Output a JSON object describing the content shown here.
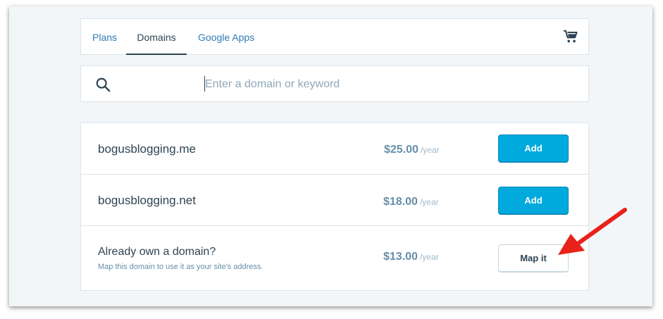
{
  "tabs": {
    "plans": "Plans",
    "domains": "Domains",
    "google_apps": "Google Apps",
    "active": "Domains"
  },
  "icons": {
    "cart": "shopping-cart-icon",
    "search": "search-icon",
    "annotation": "red-arrow-annotation"
  },
  "search": {
    "placeholder": "Enter a domain or keyword",
    "value": ""
  },
  "results": [
    {
      "domain": "bogusblogging.me",
      "price": "$25.00",
      "period": "/year",
      "action": "Add"
    },
    {
      "domain": "bogusblogging.net",
      "price": "$18.00",
      "period": "/year",
      "action": "Add"
    }
  ],
  "mapping": {
    "title": "Already own a domain?",
    "subtitle": "Map this domain to use it as your site's address.",
    "price": "$13.00",
    "period": "/year",
    "action": "Map it"
  },
  "colors": {
    "primary_button": "#00aadc",
    "link": "#2e7cb6",
    "text": "#2e4453",
    "price": "#668eaa",
    "annotation": "#e8221b"
  }
}
